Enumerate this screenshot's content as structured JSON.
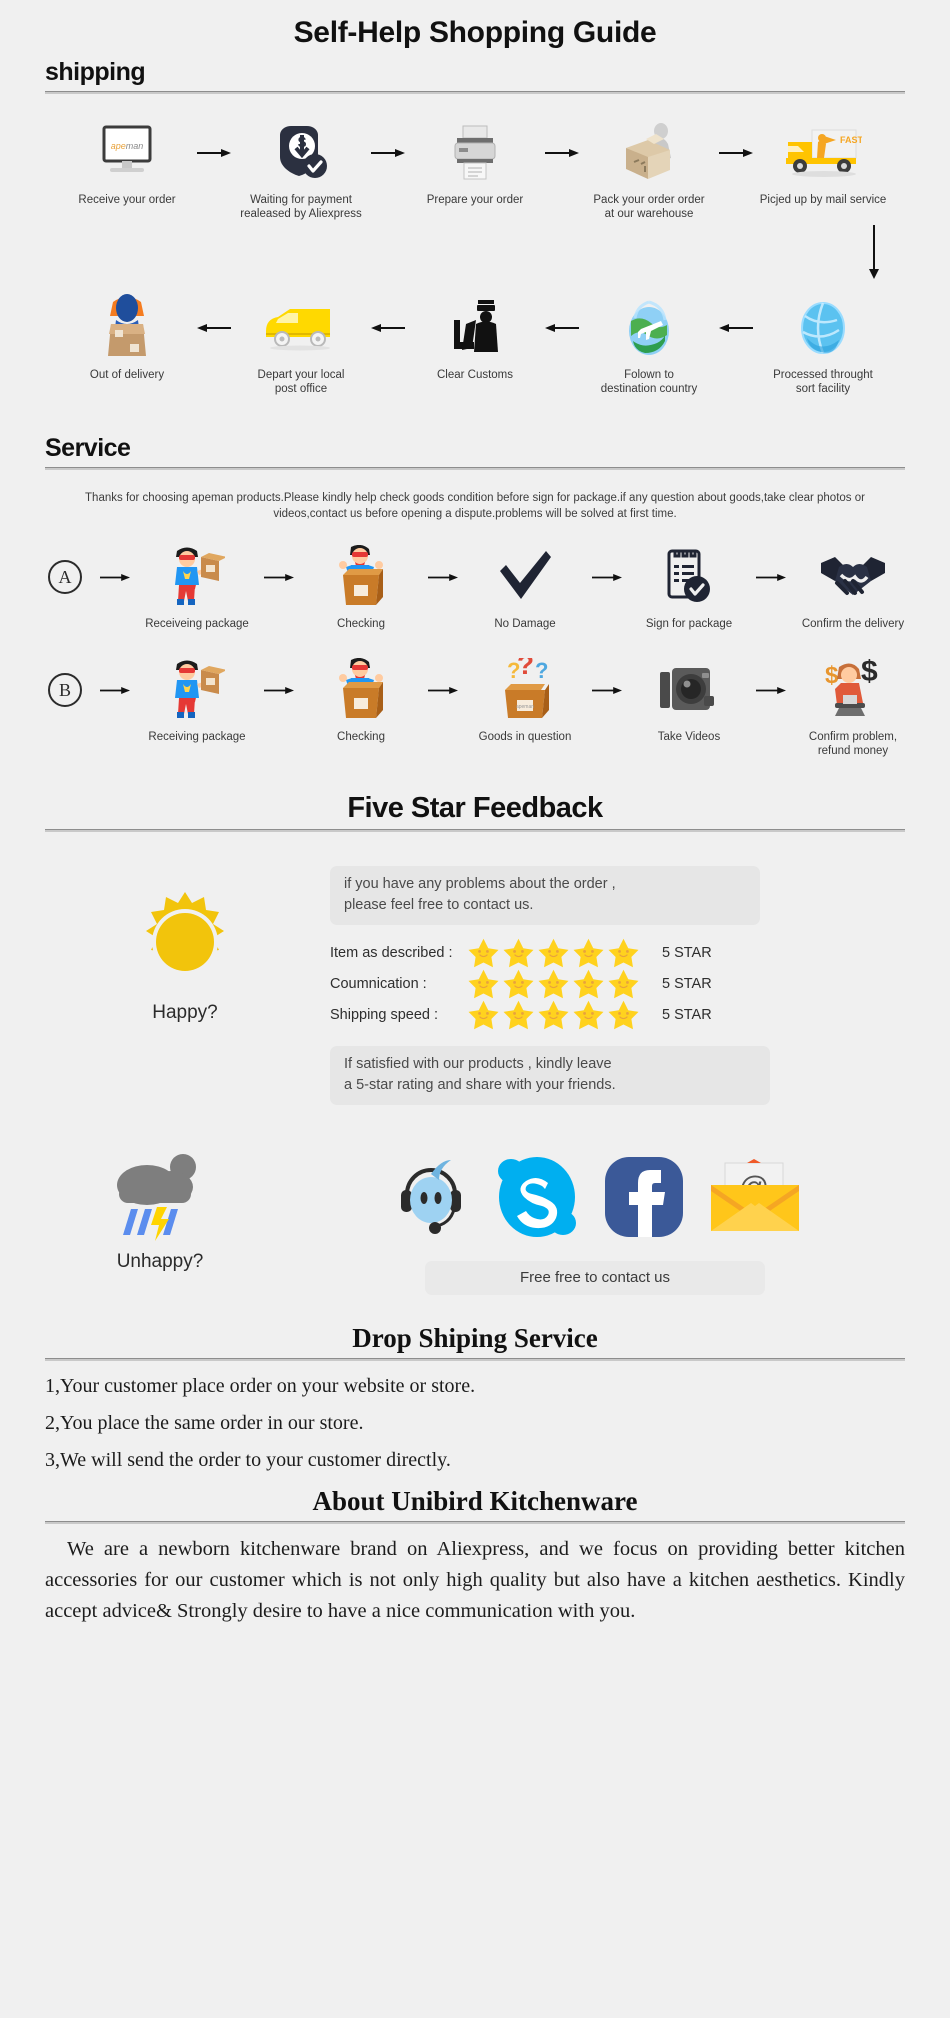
{
  "page": {
    "background": "#f0f0f0",
    "title": "Self-Help Shopping Guide"
  },
  "shipping": {
    "heading": "shipping",
    "row1": [
      {
        "icon": "monitor-apeman-icon",
        "label": "Receive your order"
      },
      {
        "icon": "payment-shield-dollar-icon",
        "label": "Waiting for payment\nrealeased by Aliexpress"
      },
      {
        "icon": "printer-icon",
        "label": "Prepare your order"
      },
      {
        "icon": "packing-box-worker-icon",
        "label": "Pack your order order\nat our warehouse"
      },
      {
        "icon": "delivery-truck-fast-icon",
        "label": "Picjed up by mail service"
      }
    ],
    "row2": [
      {
        "icon": "courier-with-box-icon",
        "label": "Out of delivery"
      },
      {
        "icon": "yellow-van-icon",
        "label": "Depart your local\npost office"
      },
      {
        "icon": "customs-officer-icon",
        "label": "Clear Customs"
      },
      {
        "icon": "globe-plane-icon",
        "label": "Folown to\ndestination country"
      },
      {
        "icon": "sort-facility-globe-icon",
        "label": "Processed throught\nsort facility"
      }
    ]
  },
  "service": {
    "heading": "Service",
    "note": "Thanks for choosing apeman products.Please kindly help check goods condition before sign for package.if any question about goods,take clear photos or videos,contact us before opening a dispute.problems will be solved at first time.",
    "rowA": {
      "badge": "A",
      "steps": [
        {
          "icon": "superhero-holding-box-icon",
          "label": "Receiveing package"
        },
        {
          "icon": "superhero-in-box-icon",
          "label": "Checking"
        },
        {
          "icon": "checkmark-icon",
          "label": "No Damage"
        },
        {
          "icon": "signed-document-icon",
          "label": "Sign for package"
        },
        {
          "icon": "handshake-icon",
          "label": "Confirm the delivery"
        }
      ]
    },
    "rowB": {
      "badge": "B",
      "steps": [
        {
          "icon": "superhero-holding-box-icon",
          "label": "Receiving package"
        },
        {
          "icon": "superhero-in-box-icon",
          "label": "Checking"
        },
        {
          "icon": "box-question-marks-icon",
          "label": "Goods in question"
        },
        {
          "icon": "camera-icon",
          "label": "Take Videos"
        },
        {
          "icon": "agent-refund-dollar-icon",
          "label": "Confirm problem,\nrefund money"
        }
      ]
    }
  },
  "feedback": {
    "heading": "Five Star Feedback",
    "mood_happy": "Happy?",
    "mood_unhappy": "Unhappy?",
    "bubble_top": "if you have any problems about the order ,\nplease feel free to contact us.",
    "bubble_bottom": "If satisfied with our products ,  kindly leave\na 5-star rating and share with your friends.",
    "ratings": [
      {
        "label": "Item as described :",
        "stars": 5,
        "value": "5 STAR"
      },
      {
        "label": "Coumnication :",
        "stars": 5,
        "value": "5 STAR"
      },
      {
        "label": "Shipping speed :",
        "stars": 5,
        "value": "5 STAR"
      }
    ],
    "contact_icons": [
      "msn-messenger-headset-icon",
      "skype-icon",
      "facebook-icon",
      "email-envelope-icon"
    ],
    "contact_bar": "Free free to contact us",
    "colors": {
      "star": "#FFD21E",
      "sun": "#F2C40C",
      "cloud": "#7e7e7e",
      "rain": "#5b8dee",
      "lightning": "#FFD400",
      "skype": "#00AFF0",
      "facebook": "#3b5998",
      "envelope": "#FFC61A"
    }
  },
  "dropshipping": {
    "heading": "Drop Shiping Service",
    "items": [
      "1,Your customer place order on your website or store.",
      "2,You place the same order in our store.",
      "3,We will send the order to your customer directly."
    ]
  },
  "about": {
    "heading": "About Unibird Kitchenware",
    "body": "We are a newborn kitchenware brand on Aliexpress, and we focus on providing better kitchen accessories for our customer which is not only high quality but also have a kitchen aesthetics. Kindly accept advice& Strongly desire to have a nice communication with you."
  }
}
